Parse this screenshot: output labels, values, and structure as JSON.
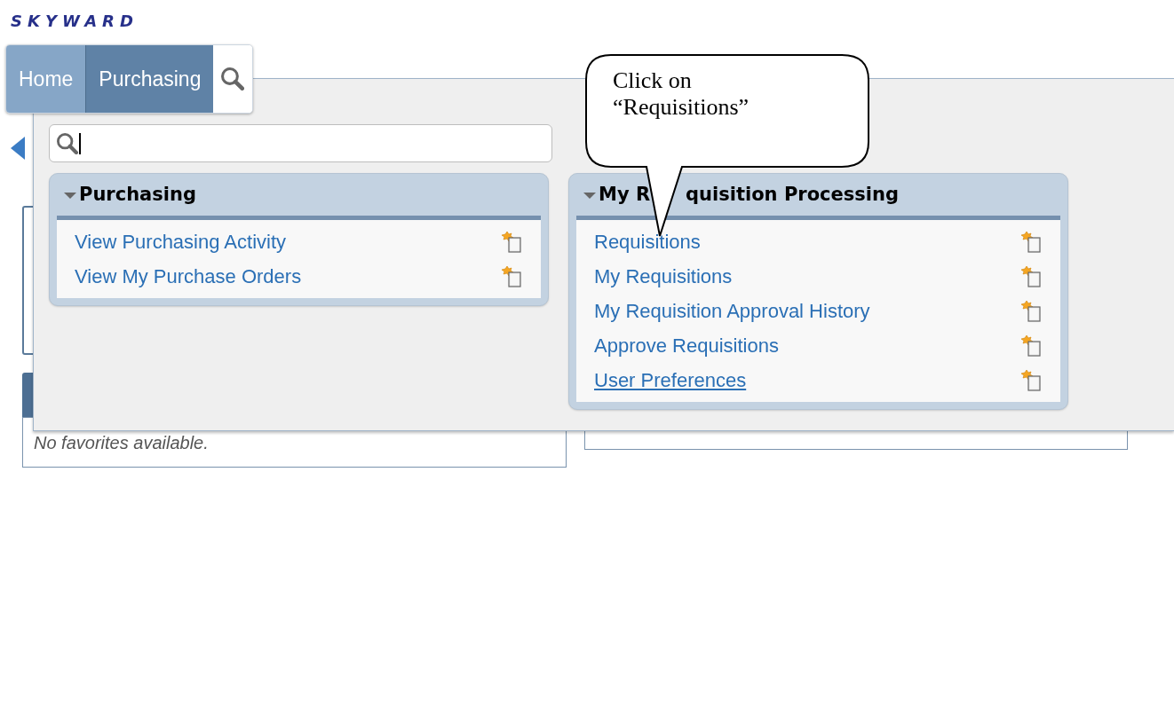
{
  "logo": {
    "text": "SKYWARD"
  },
  "nav_tabs": [
    {
      "label": "Home",
      "selected": false
    },
    {
      "label": "Purchasing",
      "selected": true
    }
  ],
  "menu": {
    "panels": [
      {
        "title_parts": [
          "Purchasing"
        ],
        "expanded": true,
        "items": [
          {
            "label": "View Purchasing Activity",
            "hovered": false
          },
          {
            "label": "View My Purchase Orders",
            "hovered": false
          }
        ]
      },
      {
        "title_parts": [
          "My R",
          "quisition Processing"
        ],
        "expanded": true,
        "items": [
          {
            "label": "Requisitions",
            "hovered": false
          },
          {
            "label": "My Requisitions",
            "hovered": false
          },
          {
            "label": "My Requisition Approval History",
            "hovered": false
          },
          {
            "label": "Approve Requisitions",
            "hovered": false
          },
          {
            "label": "User Preferences",
            "hovered": true
          }
        ]
      }
    ]
  },
  "favorites": {
    "message": "No favorites available."
  },
  "callout": {
    "text": "Click on “Requisitions”"
  }
}
